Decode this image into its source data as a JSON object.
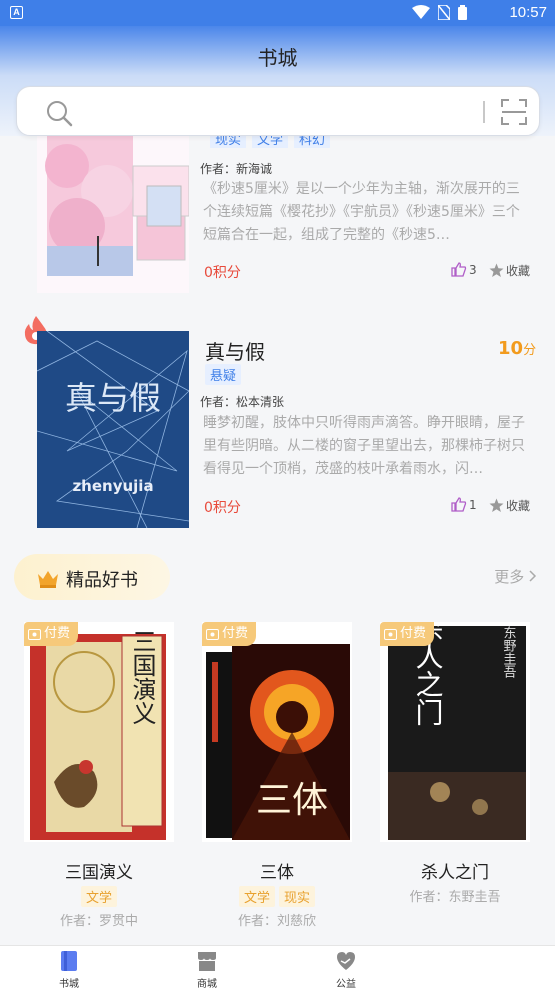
{
  "status_bar": {
    "app_badge": "A",
    "time": "10:57"
  },
  "header": {
    "title": "书城"
  },
  "search": {
    "placeholder": ""
  },
  "books": [
    {
      "tags": [
        "现实",
        "文学",
        "科幻"
      ],
      "author": "作者：新海诚",
      "description": "《秒速5厘米》是以一个少年为主轴，渐次展开的三个连续短篇《樱花抄》《宇航员》《秒速5厘米》三个短篇合在一起，组成了完整的《秒速5…",
      "points": "0积分",
      "likes": "3",
      "collect": "收藏"
    },
    {
      "title": "真与假",
      "cover_text": "真与假",
      "cover_subtitle": "zhenyujia",
      "tags": [
        "悬疑"
      ],
      "author": "作者：松本清张",
      "description": "睡梦初醒，肢体中只听得雨声滴答。睁开眼睛，屋子里有些阴暗。从二楼的窗子里望出去，那棵柿子树只看得见一个顶梢，茂盛的枝叶承着雨水，闪…",
      "points": "0积分",
      "score": "10",
      "score_unit": "分",
      "likes": "1",
      "collect": "收藏"
    }
  ],
  "section": {
    "title": "精品好书",
    "more": "更多"
  },
  "featured": [
    {
      "badge": "付费",
      "title": "三国演义",
      "cover_text": "三国演义",
      "tags": [
        "文学"
      ],
      "author": "作者：罗贯中"
    },
    {
      "badge": "付费",
      "title": "三体",
      "cover_text": "三体",
      "tags": [
        "文学",
        "现实"
      ],
      "author": "作者：刘慈欣"
    },
    {
      "badge": "付费",
      "title": "杀人之门",
      "cover_text": "杀人之门",
      "cover_author": "东野圭吾",
      "tags": [],
      "author": "作者：东野圭吾"
    }
  ],
  "tabs": [
    {
      "label": "书城"
    },
    {
      "label": "商城"
    },
    {
      "label": "公益"
    }
  ],
  "colors": {
    "accent": "#3f7fe8",
    "points": "#e84b3c",
    "score": "#f29b1e",
    "paid": "#f6c97a"
  }
}
